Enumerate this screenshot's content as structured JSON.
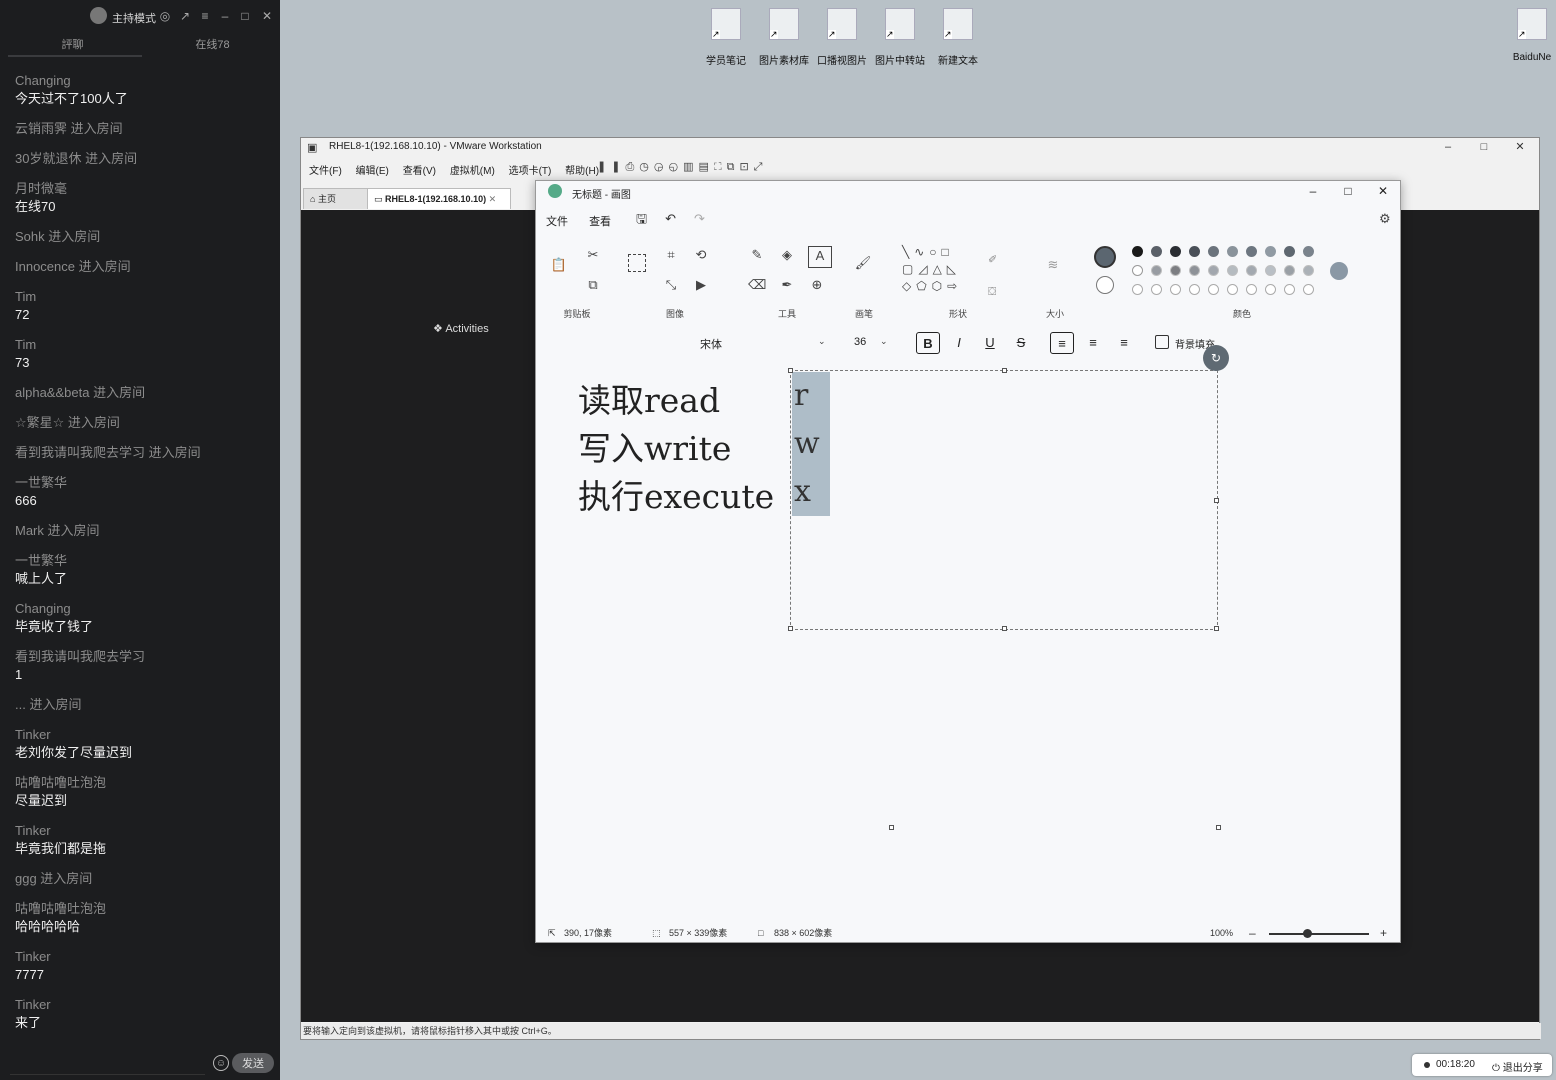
{
  "chat": {
    "title": "主持模式",
    "tabs": [
      "評聊",
      "在线78"
    ],
    "messages": [
      {
        "nick": "Changing",
        "text": "今天过不了100人了"
      },
      {
        "join": "云销雨霁 进入房间"
      },
      {
        "join": "30岁就退休 进入房间"
      },
      {
        "nick": "月时微毫",
        "text": "在线70"
      },
      {
        "join": "Sohk 进入房间"
      },
      {
        "join": "Innocence 进入房间"
      },
      {
        "nick": "Tim",
        "text": "72"
      },
      {
        "nick": "Tim",
        "text": "73"
      },
      {
        "join": "alpha&&beta 进入房间"
      },
      {
        "join": "☆繁星☆ 进入房间"
      },
      {
        "join": "看到我请叫我爬去学习 进入房间"
      },
      {
        "nick": "一世繁华",
        "text": "666"
      },
      {
        "join": "Mark 进入房间"
      },
      {
        "nick": "一世繁华",
        "text": "喊上人了"
      },
      {
        "nick": "Changing",
        "text": "毕竟收了钱了"
      },
      {
        "nick": "看到我请叫我爬去学习",
        "text": "1"
      },
      {
        "join": "... 进入房间"
      },
      {
        "nick": "Tinker",
        "text": "老刘你发了尽量迟到"
      },
      {
        "nick": "咕噜咕噜吐泡泡",
        "text": "尽量迟到"
      },
      {
        "nick": "Tinker",
        "text": "毕竟我们都是拖"
      },
      {
        "join": "ggg 进入房间"
      },
      {
        "nick": "咕噜咕噜吐泡泡",
        "text": "哈哈哈哈哈"
      },
      {
        "nick": "Tinker",
        "text": "7777"
      },
      {
        "nick": "Tinker",
        "text": "来了"
      }
    ],
    "send_label": "发送"
  },
  "desktop": {
    "icons": [
      "学员笔记",
      "图片素材库",
      "口播视图片",
      "图片中转站",
      "新建文本",
      "BaiduNe"
    ]
  },
  "vmware": {
    "title": "RHEL8-1(192.168.10.10) - VMware Workstation",
    "menu": [
      "文件(F)",
      "编辑(E)",
      "查看(V)",
      "虚拟机(M)",
      "选项卡(T)",
      "帮助(H)"
    ],
    "tabs": [
      "主页",
      "RHEL8-1(192.168.10.10)"
    ],
    "activities": "Activities",
    "status_text": "要将输入定向到该虚拟机，请将鼠标指针移入其中或按 Ctrl+G。"
  },
  "paint": {
    "title": "无标题 - 画图",
    "menu": [
      "文件",
      "查看"
    ],
    "groups": {
      "clipboard": "剪贴板",
      "image": "图像",
      "tools": "工具",
      "brushes": "画笔",
      "shapes": "形状",
      "size": "大小",
      "colors": "颜色"
    },
    "font_name": "宋体",
    "font_size": "36",
    "bg_fill_label": "背景填充",
    "canvas_lines": [
      "读取read",
      "写入write",
      "执行execute"
    ],
    "perm_letters": [
      "r",
      "w",
      "x"
    ],
    "status": {
      "cursor": "390, 17像素",
      "selection": "557 × 339像素",
      "canvas": "838 × 602像素",
      "zoom": "100%"
    },
    "palette_row1": [
      "#1a1a1a",
      "#5a6068",
      "#2b2e33",
      "#4a5058",
      "#6b737c",
      "#8a939b",
      "#6d7680",
      "#909aa3",
      "#5e6770",
      "#7a838c"
    ],
    "primary_color": "#5b6670",
    "zoom_fraction": 0.38
  },
  "share": {
    "time": "00:18:20",
    "exit_label": "退出分享"
  }
}
